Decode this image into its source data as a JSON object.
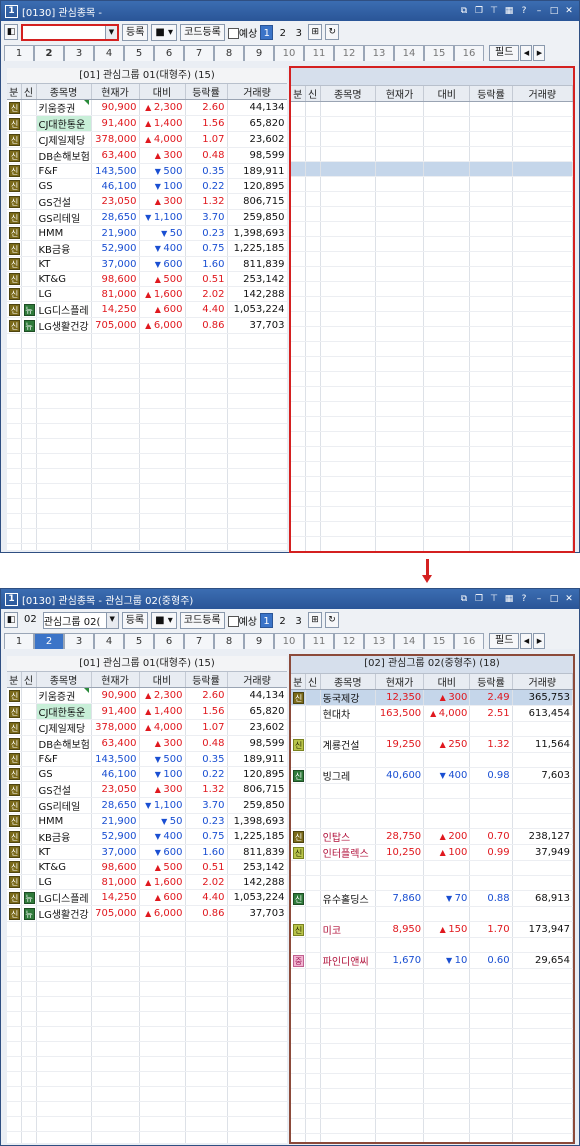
{
  "win1": {
    "title": "[0130] 관심종목 -",
    "input_value": "",
    "page_active": "1",
    "tab_active": "2"
  },
  "win2": {
    "title": "[0130] 관심종목 - 관심그룹 02(중형주)",
    "input_value": "02",
    "group_value": "관심그룹 02(",
    "page_active": "1",
    "tab_active": "2"
  },
  "toolbar": {
    "register": "등록",
    "code_register": "코드등록",
    "forecast": "예상",
    "pages": [
      "1",
      "2",
      "3"
    ],
    "square": "■",
    "field": "필드"
  },
  "tabs": [
    "1",
    "2",
    "3",
    "4",
    "5",
    "6",
    "7",
    "8",
    "9",
    "10",
    "11",
    "12",
    "13",
    "14",
    "15",
    "16"
  ],
  "columns": [
    "분",
    "신",
    "종목명",
    "현재가",
    "대비",
    "등락률",
    "거래량"
  ],
  "left_group_title": "[01] 관심그룹 01(대형주) (15)",
  "right_group_title": "[02] 관심그룹 02(중형주) (18)",
  "left_rows": [
    {
      "b": "신",
      "s": "",
      "name": "키움증권",
      "price": "90,900",
      "dir": "up",
      "chg": "2,300",
      "rate": "2.60",
      "vol": "44,134",
      "mark": true
    },
    {
      "b": "신",
      "s": "",
      "name": "CJ대한통운",
      "price": "91,400",
      "dir": "up",
      "chg": "1,400",
      "rate": "1.56",
      "vol": "65,820",
      "hl": "green"
    },
    {
      "b": "신",
      "s": "",
      "name": "CJ제일제당",
      "price": "378,000",
      "dir": "up",
      "chg": "4,000",
      "rate": "1.07",
      "vol": "23,602"
    },
    {
      "b": "신",
      "s": "",
      "name": "DB손해보험",
      "price": "63,400",
      "dir": "up",
      "chg": "300",
      "rate": "0.48",
      "vol": "98,599"
    },
    {
      "b": "신",
      "s": "",
      "name": "F&F",
      "price": "143,500",
      "dir": "dn",
      "chg": "500",
      "rate": "0.35",
      "vol": "189,911"
    },
    {
      "b": "신",
      "s": "",
      "name": "GS",
      "price": "46,100",
      "dir": "dn",
      "chg": "100",
      "rate": "0.22",
      "vol": "120,895"
    },
    {
      "b": "신",
      "s": "",
      "name": "GS건설",
      "price": "23,050",
      "dir": "up",
      "chg": "300",
      "rate": "1.32",
      "vol": "806,715"
    },
    {
      "b": "신",
      "s": "",
      "name": "GS리테일",
      "price": "28,650",
      "dir": "dn",
      "chg": "1,100",
      "rate": "3.70",
      "vol": "259,850"
    },
    {
      "b": "신",
      "s": "",
      "name": "HMM",
      "price": "21,900",
      "dir": "dn",
      "chg": "50",
      "rate": "0.23",
      "vol": "1,398,693"
    },
    {
      "b": "신",
      "s": "",
      "name": "KB금융",
      "price": "52,900",
      "dir": "dn",
      "chg": "400",
      "rate": "0.75",
      "vol": "1,225,185"
    },
    {
      "b": "신",
      "s": "",
      "name": "KT",
      "price": "37,000",
      "dir": "dn",
      "chg": "600",
      "rate": "1.60",
      "vol": "811,839"
    },
    {
      "b": "신",
      "s": "",
      "name": "KT&G",
      "price": "98,600",
      "dir": "up",
      "chg": "500",
      "rate": "0.51",
      "vol": "253,142"
    },
    {
      "b": "신",
      "s": "",
      "name": "LG",
      "price": "81,000",
      "dir": "up",
      "chg": "1,600",
      "rate": "2.02",
      "vol": "142,288"
    },
    {
      "b": "신",
      "s": "뉴",
      "name": "LG디스플레",
      "price": "14,250",
      "dir": "up",
      "chg": "600",
      "rate": "4.40",
      "vol": "1,053,224"
    },
    {
      "b": "신",
      "s": "뉴",
      "name": "LG생활건강",
      "price": "705,000",
      "dir": "up",
      "chg": "6,000",
      "rate": "0.86",
      "vol": "37,703"
    }
  ],
  "right_rows": [
    {
      "b": "신",
      "s": "",
      "name": "동국제강",
      "price": "12,350",
      "dir": "up",
      "chg": "300",
      "rate": "2.49",
      "vol": "365,753",
      "hl": "blue"
    },
    {
      "b": "",
      "s": "",
      "name": "현대차",
      "price": "163,500",
      "dir": "up",
      "chg": "4,000",
      "rate": "2.51",
      "vol": "613,454"
    },
    {
      "b": "",
      "s": "",
      "name": "",
      "price": "",
      "dir": "",
      "chg": "",
      "rate": "",
      "vol": ""
    },
    {
      "b": "신",
      "s": "",
      "name": "계룡건설",
      "price": "19,250",
      "dir": "up",
      "chg": "250",
      "rate": "1.32",
      "vol": "11,564",
      "bc": "lg"
    },
    {
      "b": "",
      "s": "",
      "name": "",
      "price": "",
      "dir": "",
      "chg": "",
      "rate": "",
      "vol": ""
    },
    {
      "b": "신",
      "s": "",
      "name": "빙그레",
      "price": "40,600",
      "dir": "dn",
      "chg": "400",
      "rate": "0.98",
      "vol": "7,603",
      "bc": "g"
    },
    {
      "b": "",
      "s": "",
      "name": "",
      "price": "",
      "dir": "",
      "chg": "",
      "rate": "",
      "vol": ""
    },
    {
      "b": "",
      "s": "",
      "name": "",
      "price": "",
      "dir": "",
      "chg": "",
      "rate": "",
      "vol": ""
    },
    {
      "b": "",
      "s": "",
      "name": "",
      "price": "",
      "dir": "",
      "chg": "",
      "rate": "",
      "vol": ""
    },
    {
      "b": "신",
      "s": "",
      "name": "인탑스",
      "price": "28,750",
      "dir": "up",
      "chg": "200",
      "rate": "0.70",
      "vol": "238,127",
      "nc": "up"
    },
    {
      "b": "신",
      "s": "",
      "name": "인터플렉스",
      "price": "10,250",
      "dir": "up",
      "chg": "100",
      "rate": "0.99",
      "vol": "37,949",
      "nc": "up",
      "bc": "lg"
    },
    {
      "b": "",
      "s": "",
      "name": "",
      "price": "",
      "dir": "",
      "chg": "",
      "rate": "",
      "vol": ""
    },
    {
      "b": "",
      "s": "",
      "name": "",
      "price": "",
      "dir": "",
      "chg": "",
      "rate": "",
      "vol": ""
    },
    {
      "b": "신",
      "s": "",
      "name": "유수홀딩스",
      "price": "7,860",
      "dir": "dn",
      "chg": "70",
      "rate": "0.88",
      "vol": "68,913",
      "bc": "g"
    },
    {
      "b": "",
      "s": "",
      "name": "",
      "price": "",
      "dir": "",
      "chg": "",
      "rate": "",
      "vol": ""
    },
    {
      "b": "신",
      "s": "",
      "name": "미코",
      "price": "8,950",
      "dir": "up",
      "chg": "150",
      "rate": "1.70",
      "vol": "173,947",
      "nc": "up",
      "bc": "lg"
    },
    {
      "b": "",
      "s": "",
      "name": "",
      "price": "",
      "dir": "",
      "chg": "",
      "rate": "",
      "vol": ""
    },
    {
      "b": "중",
      "s": "",
      "name": "파인디앤씨",
      "price": "1,670",
      "dir": "dn",
      "chg": "10",
      "rate": "0.60",
      "vol": "29,654",
      "nc": "up",
      "bc": "pink"
    }
  ],
  "colors": {
    "up": "#e0181e",
    "down": "#1a4fd2",
    "accent": "#3b74c8",
    "frame": "#d42020"
  }
}
